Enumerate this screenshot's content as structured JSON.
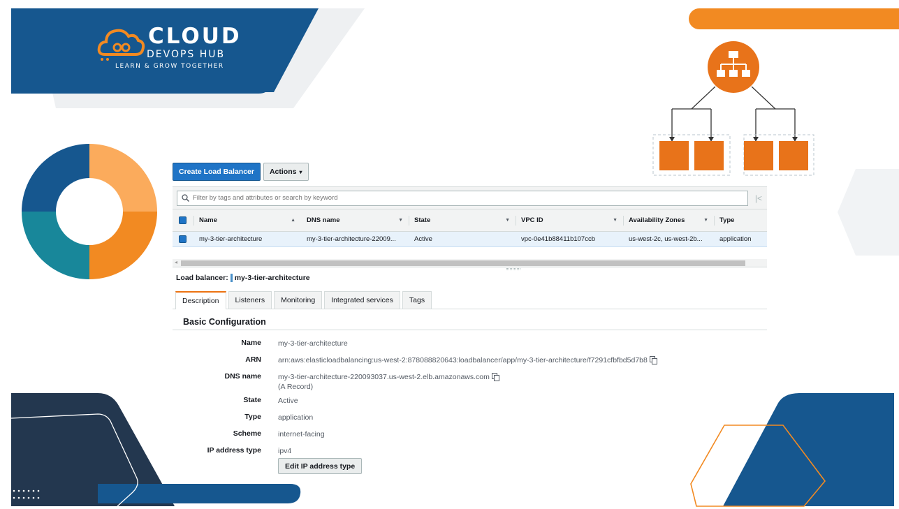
{
  "brand": {
    "line1": "CLOUD",
    "line2": "DEVOPS HUB",
    "tagline": "LEARN & GROW TOGETHER",
    "colors": {
      "navy": "#16578f",
      "orange": "#f28a22",
      "teal": "#18879a",
      "dark": "#23374f"
    }
  },
  "toolbar": {
    "create_label": "Create Load Balancer",
    "actions_label": "Actions"
  },
  "search": {
    "placeholder": "Filter by tags and attributes or search by keyword"
  },
  "table": {
    "columns": [
      "Name",
      "DNS name",
      "State",
      "VPC ID",
      "Availability Zones",
      "Type"
    ],
    "rows": [
      {
        "name": "my-3-tier-architecture",
        "dns": "my-3-tier-architecture-22009...",
        "state": "Active",
        "vpc": "vpc-0e41b88411b107ccb",
        "az": "us-west-2c, us-west-2b...",
        "type": "application"
      }
    ]
  },
  "detail": {
    "title_prefix": "Load balancer:",
    "title_name": "my-3-tier-architecture",
    "tabs": [
      "Description",
      "Listeners",
      "Monitoring",
      "Integrated services",
      "Tags"
    ],
    "active_tab": "Description",
    "section": "Basic Configuration",
    "fields": {
      "name": {
        "label": "Name",
        "value": "my-3-tier-architecture"
      },
      "arn": {
        "label": "ARN",
        "value": "arn:aws:elasticloadbalancing:us-west-2:878088820643:loadbalancer/app/my-3-tier-architecture/f7291cfbfbd5d7b8"
      },
      "dns": {
        "label": "DNS name",
        "value": "my-3-tier-architecture-220093037.us-west-2.elb.amazonaws.com",
        "note": "(A Record)"
      },
      "state": {
        "label": "State",
        "value": "Active"
      },
      "type": {
        "label": "Type",
        "value": "application"
      },
      "scheme": {
        "label": "Scheme",
        "value": "internet-facing"
      },
      "ip_type": {
        "label": "IP address type",
        "value": "ipv4"
      }
    },
    "edit_ip_label": "Edit IP address type"
  }
}
